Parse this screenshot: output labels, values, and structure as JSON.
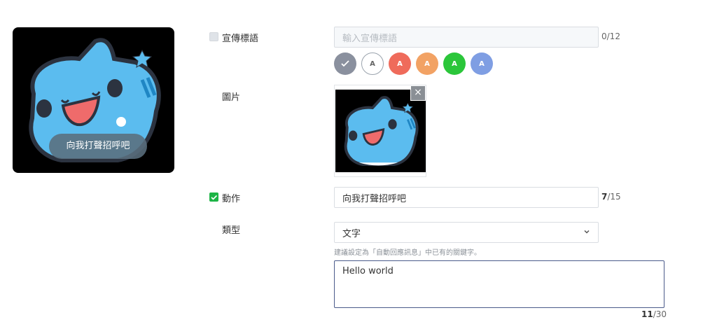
{
  "preview": {
    "caption": "向我打聲招呼吧"
  },
  "tagline": {
    "label": "宣傳標語",
    "checked": false,
    "placeholder": "輸入宣傳標語",
    "value": "",
    "count": "0",
    "max": "/12"
  },
  "colors": {
    "options": [
      {
        "name": "gray",
        "color": "#8a909e",
        "text": "✓"
      },
      {
        "name": "white",
        "color": "#ffffff",
        "text": "A"
      },
      {
        "name": "red",
        "color": "#ef6b5b",
        "text": "A"
      },
      {
        "name": "orange",
        "color": "#f2a264",
        "text": "A"
      },
      {
        "name": "green",
        "color": "#2bc63a",
        "text": "A"
      },
      {
        "name": "blue",
        "color": "#7f9ee3",
        "text": "A"
      }
    ]
  },
  "image": {
    "label": "圖片",
    "close": "×"
  },
  "action": {
    "label": "動作",
    "checked": true,
    "value": "向我打聲招呼吧",
    "count": "7",
    "max": "/15"
  },
  "type": {
    "label": "類型",
    "value": "文字",
    "hint": "建議設定為「自動回應訊息」中已有的關鍵字。"
  },
  "message": {
    "value": "Hello world",
    "count": "11",
    "max": "/30"
  }
}
